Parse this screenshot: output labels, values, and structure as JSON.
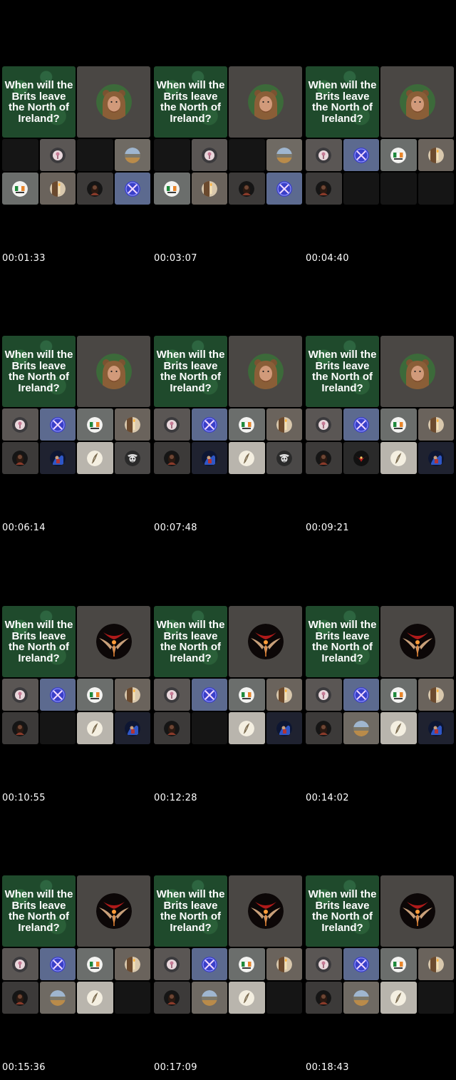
{
  "title_text": "When will the Brits leave the North of Ireland?",
  "speaker_icons": {
    "bear": "bear-hood-man-avatar",
    "phoenix": "red-phoenix-avatar"
  },
  "frames": [
    {
      "timestamp": "00:01:33",
      "speaker": "bear",
      "participants": [
        "empty",
        "pink-flower",
        "empty",
        "landscape",
        "irish-crest",
        "candle",
        "dark-woman",
        "crossed-swords"
      ]
    },
    {
      "timestamp": "00:03:07",
      "speaker": "bear",
      "participants": [
        "empty",
        "pink-flower",
        "empty",
        "landscape",
        "irish-crest",
        "candle",
        "dark-woman",
        "crossed-swords"
      ]
    },
    {
      "timestamp": "00:04:40",
      "speaker": "bear",
      "participants": [
        "pink-flower",
        "crossed-swords",
        "irish-crest",
        "candle",
        "dark-woman",
        "empty",
        "empty",
        "empty"
      ]
    },
    {
      "timestamp": "00:06:14",
      "speaker": "bear",
      "participants": [
        "pink-flower",
        "crossed-swords",
        "irish-crest",
        "candle",
        "dark-woman",
        "blue-figure",
        "feather",
        "skull"
      ]
    },
    {
      "timestamp": "00:07:48",
      "speaker": "bear",
      "participants": [
        "pink-flower",
        "crossed-swords",
        "irish-crest",
        "candle",
        "dark-woman",
        "blue-figure",
        "feather",
        "skull"
      ]
    },
    {
      "timestamp": "00:09:21",
      "speaker": "bear",
      "participants": [
        "pink-flower",
        "crossed-swords",
        "irish-crest",
        "candle",
        "dark-woman",
        "red-bird",
        "feather",
        "blue-figure"
      ]
    },
    {
      "timestamp": "00:10:55",
      "speaker": "phoenix",
      "participants": [
        "pink-flower",
        "crossed-swords",
        "irish-crest",
        "candle",
        "dark-woman",
        "empty",
        "feather",
        "blue-figure"
      ]
    },
    {
      "timestamp": "00:12:28",
      "speaker": "phoenix",
      "participants": [
        "pink-flower",
        "crossed-swords",
        "irish-crest",
        "candle",
        "dark-woman",
        "empty",
        "feather",
        "blue-figure"
      ]
    },
    {
      "timestamp": "00:14:02",
      "speaker": "phoenix",
      "participants": [
        "pink-flower",
        "crossed-swords",
        "irish-crest",
        "candle",
        "dark-woman",
        "landscape",
        "feather",
        "blue-figure"
      ]
    },
    {
      "timestamp": "00:15:36",
      "speaker": "phoenix",
      "participants": [
        "pink-flower",
        "crossed-swords",
        "irish-crest",
        "candle",
        "dark-woman",
        "landscape",
        "feather",
        "empty"
      ]
    },
    {
      "timestamp": "00:17:09",
      "speaker": "phoenix",
      "participants": [
        "pink-flower",
        "crossed-swords",
        "irish-crest",
        "candle",
        "dark-woman",
        "landscape",
        "feather",
        "empty"
      ]
    },
    {
      "timestamp": "00:18:43",
      "speaker": "phoenix",
      "participants": [
        "pink-flower",
        "crossed-swords",
        "irish-crest",
        "candle",
        "dark-woman",
        "landscape",
        "feather",
        "empty"
      ]
    }
  ],
  "tile_colors": {
    "pink-flower": "#5a5654",
    "crossed-swords": "#5c6a8f",
    "irish-crest": "#6b6e6c",
    "candle": "#6a635c",
    "dark-woman": "#3c3a39",
    "blue-figure": "#1f2230",
    "feather": "#b9b5ad",
    "skull": "#4a4847",
    "landscape": "#6f6a63",
    "red-bird": "#2a2a2a"
  }
}
